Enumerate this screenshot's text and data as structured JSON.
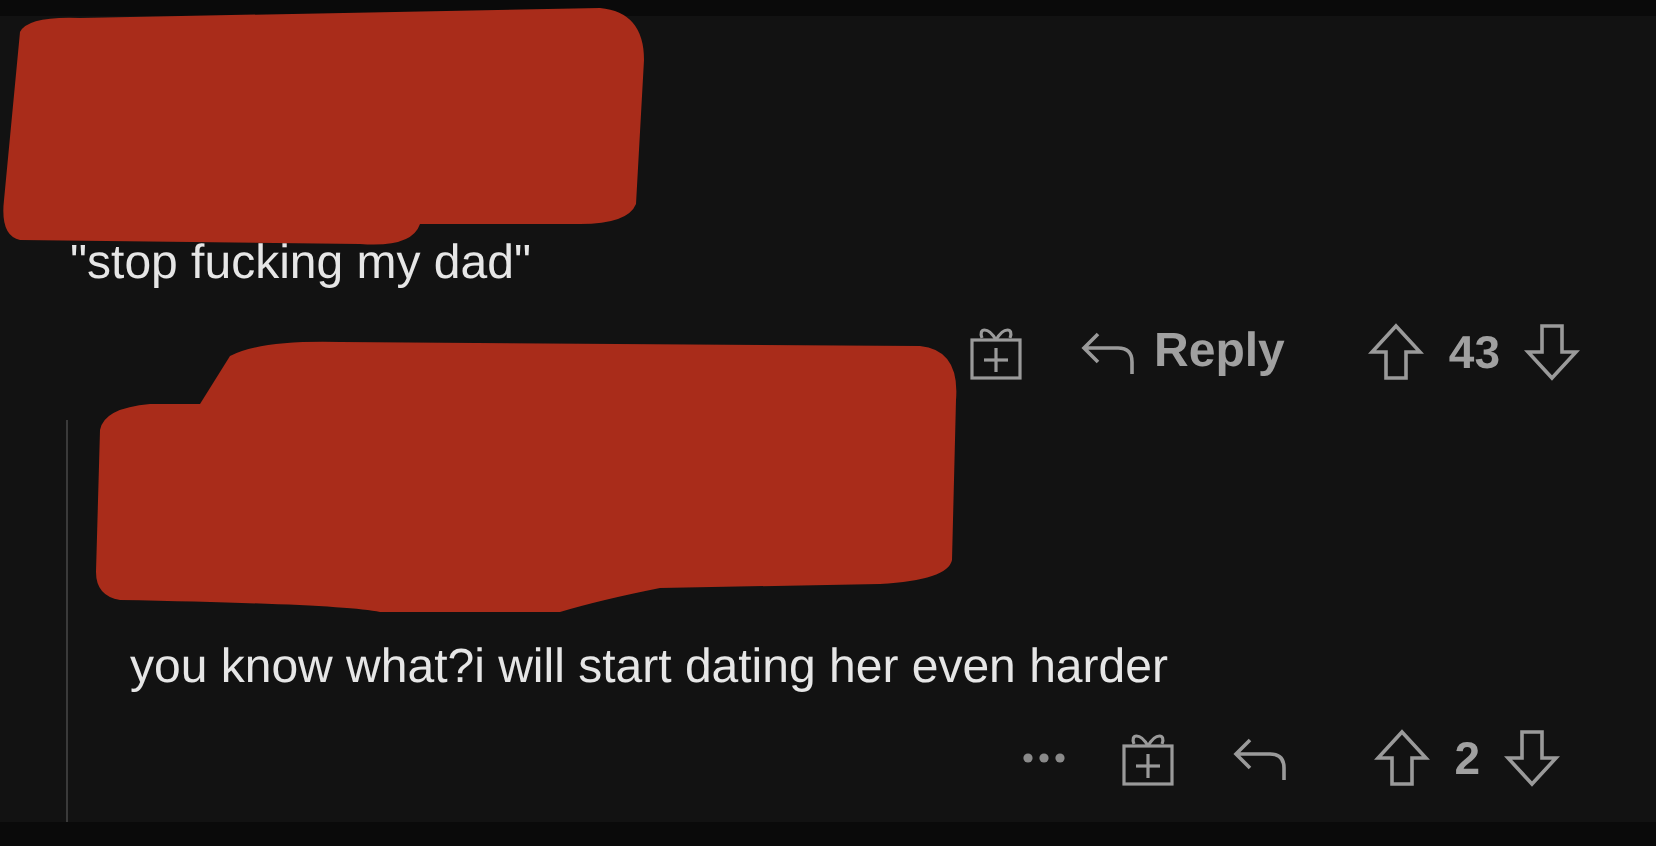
{
  "comments": [
    {
      "header_redacted": true,
      "body": "\"stop fucking my dad\"",
      "more_visible": false,
      "reply_label": "Reply",
      "score": "43",
      "nested": false
    },
    {
      "header_redacted": true,
      "body": "you know what?i will start dating her even harder",
      "more_visible": true,
      "score": "2",
      "nested": true
    }
  ]
}
